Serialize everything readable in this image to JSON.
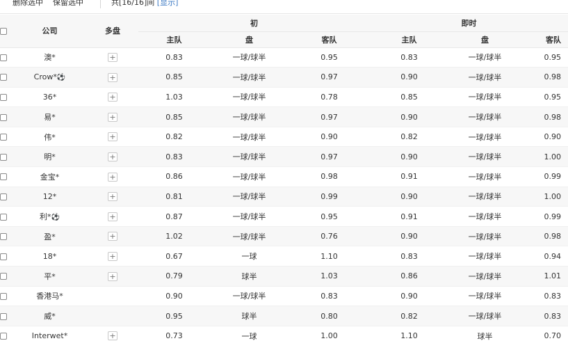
{
  "toolbar": {
    "delete_selected": "删除选中",
    "keep_selected": "保留选中",
    "count_prefix": "共[",
    "count_value": "16/16",
    "count_suffix": "]间",
    "show_link": "[显示]"
  },
  "header": {
    "company": "公司",
    "multi": "多盘",
    "initial_group": "初",
    "live_group": "即时",
    "home": "主队",
    "line": "盘",
    "away": "客队"
  },
  "icons": {
    "plus": "plus-icon",
    "ball": "soccer-ball-icon"
  },
  "rows": [
    {
      "company": "澳*",
      "ball": false,
      "multi": true,
      "i_home": "0.83",
      "i_line": "一球/球半",
      "i_away": "0.95",
      "l_home": "0.83",
      "l_line": "一球/球半",
      "l_away": "0.95"
    },
    {
      "company": "Crow*",
      "ball": true,
      "multi": true,
      "i_home": "0.85",
      "i_line": "一球/球半",
      "i_away": "0.97",
      "l_home": "0.90",
      "l_line": "一球/球半",
      "l_away": "0.98"
    },
    {
      "company": "36*",
      "ball": false,
      "multi": true,
      "i_home": "1.03",
      "i_line": "一球/球半",
      "i_away": "0.78",
      "l_home": "0.85",
      "l_line": "一球/球半",
      "l_away": "0.95"
    },
    {
      "company": "易*",
      "ball": false,
      "multi": true,
      "i_home": "0.85",
      "i_line": "一球/球半",
      "i_away": "0.97",
      "l_home": "0.90",
      "l_line": "一球/球半",
      "l_away": "0.98"
    },
    {
      "company": "伟*",
      "ball": false,
      "multi": true,
      "i_home": "0.82",
      "i_line": "一球/球半",
      "i_away": "0.90",
      "l_home": "0.82",
      "l_line": "一球/球半",
      "l_away": "0.90"
    },
    {
      "company": "明*",
      "ball": false,
      "multi": true,
      "i_home": "0.83",
      "i_line": "一球/球半",
      "i_away": "0.97",
      "l_home": "0.90",
      "l_line": "一球/球半",
      "l_away": "1.00"
    },
    {
      "company": "金宝*",
      "ball": false,
      "multi": true,
      "i_home": "0.86",
      "i_line": "一球/球半",
      "i_away": "0.98",
      "l_home": "0.91",
      "l_line": "一球/球半",
      "l_away": "0.99"
    },
    {
      "company": "12*",
      "ball": false,
      "multi": true,
      "i_home": "0.81",
      "i_line": "一球/球半",
      "i_away": "0.99",
      "l_home": "0.90",
      "l_line": "一球/球半",
      "l_away": "1.00"
    },
    {
      "company": "利*",
      "ball": true,
      "multi": true,
      "i_home": "0.87",
      "i_line": "一球/球半",
      "i_away": "0.95",
      "l_home": "0.91",
      "l_line": "一球/球半",
      "l_away": "0.99"
    },
    {
      "company": "盈*",
      "ball": false,
      "multi": true,
      "i_home": "1.02",
      "i_line": "一球/球半",
      "i_away": "0.76",
      "l_home": "0.90",
      "l_line": "一球/球半",
      "l_away": "0.98"
    },
    {
      "company": "18*",
      "ball": false,
      "multi": true,
      "i_home": "0.67",
      "i_line": "一球",
      "i_away": "1.10",
      "l_home": "0.83",
      "l_line": "一球/球半",
      "l_away": "0.94"
    },
    {
      "company": "平*",
      "ball": false,
      "multi": true,
      "i_home": "0.79",
      "i_line": "球半",
      "i_away": "1.03",
      "l_home": "0.86",
      "l_line": "一球/球半",
      "l_away": "1.01"
    },
    {
      "company": "香港马*",
      "ball": false,
      "multi": false,
      "i_home": "0.90",
      "i_line": "一球/球半",
      "i_away": "0.83",
      "l_home": "0.90",
      "l_line": "一球/球半",
      "l_away": "0.83"
    },
    {
      "company": "威*",
      "ball": false,
      "multi": false,
      "i_home": "0.95",
      "i_line": "球半",
      "i_away": "0.80",
      "l_home": "0.82",
      "l_line": "一球/球半",
      "l_away": "0.83"
    },
    {
      "company": "Interwet*",
      "ball": false,
      "multi": true,
      "i_home": "0.73",
      "i_line": "一球",
      "i_away": "1.00",
      "l_home": "1.10",
      "l_line": "球半",
      "l_away": "0.70"
    }
  ]
}
